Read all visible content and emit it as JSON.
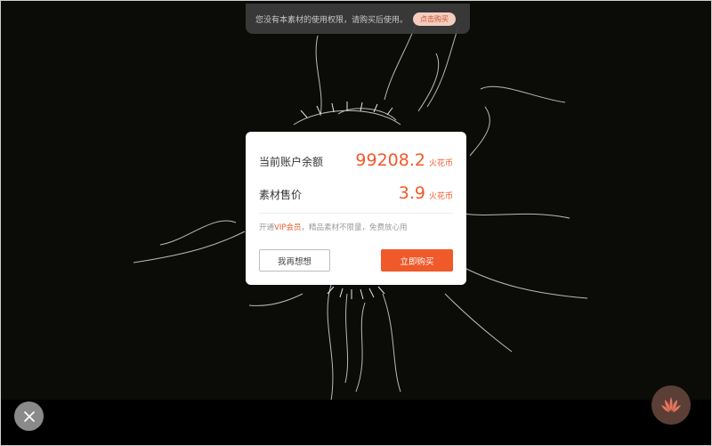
{
  "notice": {
    "text": "您没有本素材的使用权限，请购买后使用。",
    "button_label": "点击购买"
  },
  "modal": {
    "balance_label": "当前账户余额",
    "balance_value": "99208.2",
    "balance_unit": "火花币",
    "price_label": "素材售价",
    "price_value": "3.9",
    "price_unit": "火花币",
    "vip_prefix": "开通",
    "vip_link": "VIP会员",
    "vip_suffix": "，精品素材不限量，免费放心用",
    "cancel_label": "我再想想",
    "buy_label": "立即购买"
  },
  "icons": {
    "close": "close-icon",
    "logo": "brand-logo-icon"
  },
  "colors": {
    "accent": "#f0592a",
    "notice_bg": "#3c3c3c",
    "page_bg": "#0b0b08"
  }
}
